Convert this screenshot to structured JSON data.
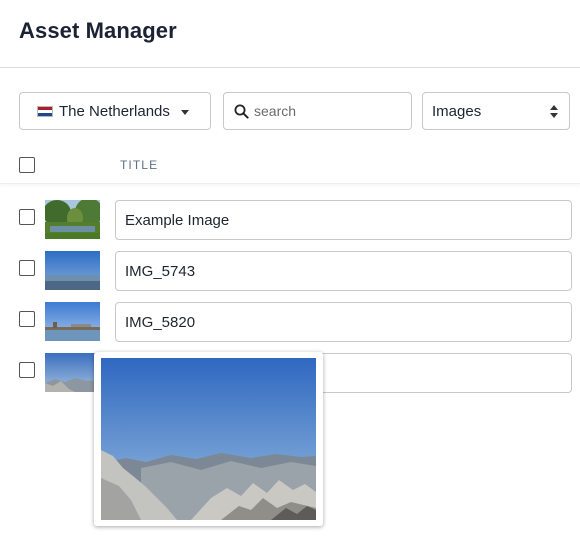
{
  "app": {
    "title": "Asset Manager"
  },
  "toolbar": {
    "locale": {
      "label": "The Netherlands",
      "flag_colors": [
        "#ae1c28",
        "#ffffff",
        "#21468b"
      ]
    },
    "search": {
      "placeholder": "search",
      "value": ""
    },
    "type_select": {
      "selected": "Images"
    }
  },
  "table": {
    "columns": {
      "title": "TITLE"
    },
    "rows": [
      {
        "title": "Example Image",
        "thumb": "park-pond"
      },
      {
        "title": "IMG_5743",
        "thumb": "aerial-city-sky"
      },
      {
        "title": "IMG_5820",
        "thumb": "harbor-bridge"
      },
      {
        "title": "",
        "thumb": "mountain-ridge"
      }
    ]
  },
  "hover_preview": {
    "image": "mountain-ridge"
  },
  "colors": {
    "border": "#c9c9c9",
    "heading": "#1b2233",
    "column_header": "#5f6f86"
  }
}
